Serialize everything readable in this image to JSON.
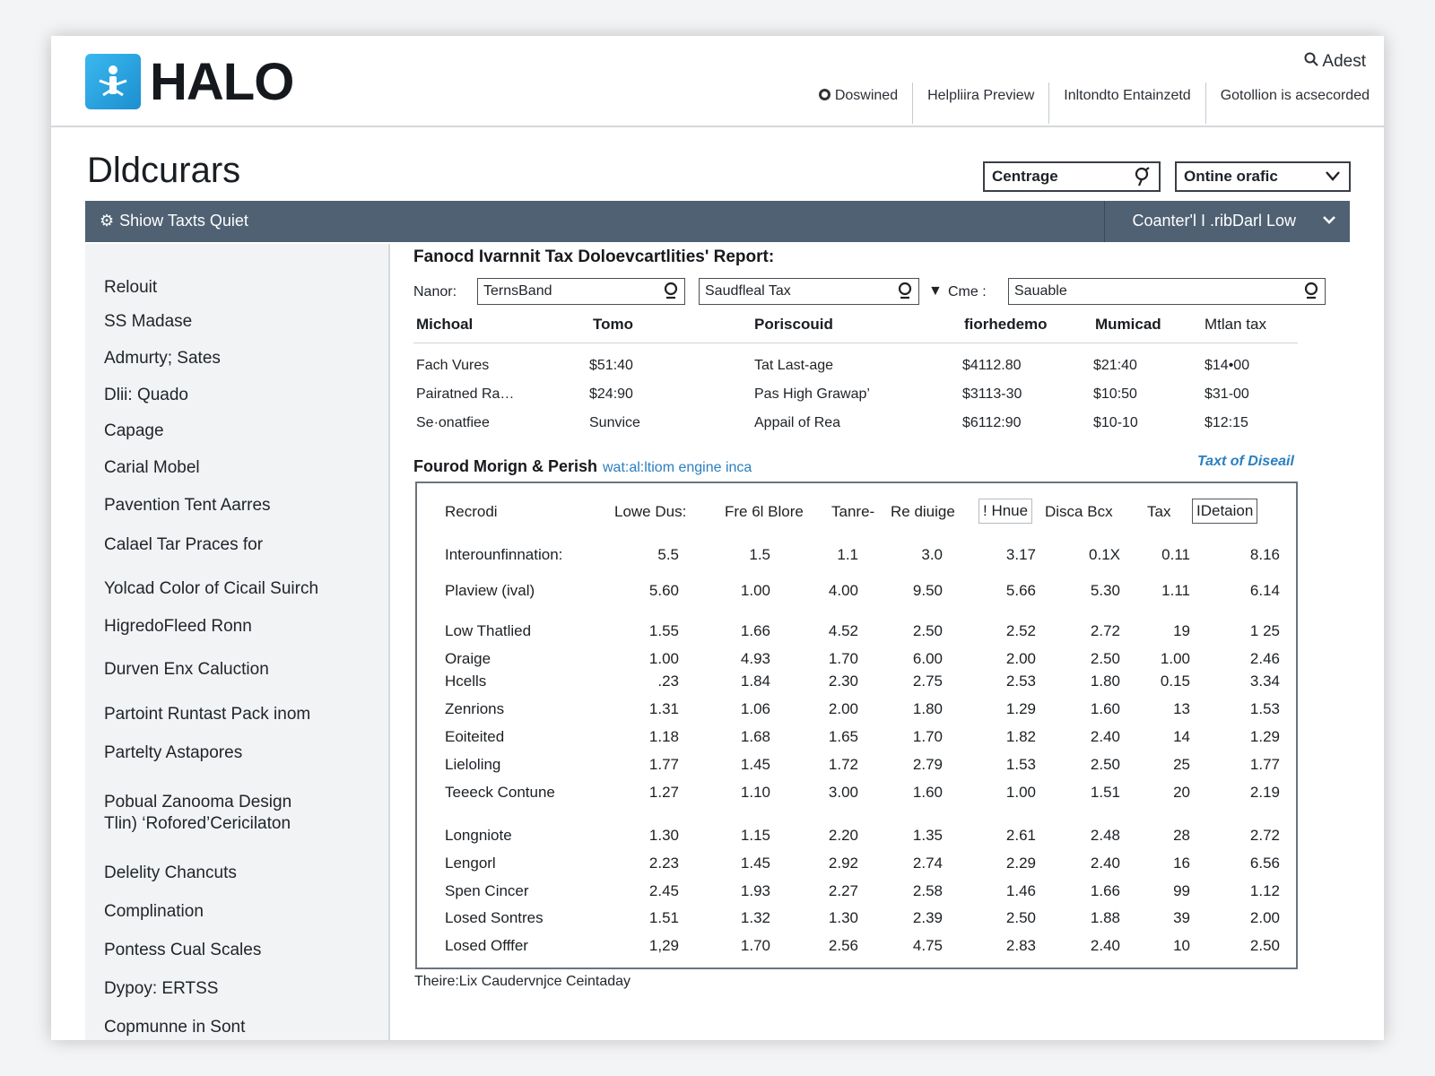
{
  "app": {
    "logo_text": "HALO",
    "user_menu": "Adest",
    "top_nav": [
      "Doswined",
      "Helpliira Preview",
      "Inltondto Entainzetd",
      "Gotollion is acsecorded"
    ]
  },
  "page": {
    "title": "Dldcurars",
    "select1": "Centrage",
    "select2": "Ontine orafic"
  },
  "toolbar": {
    "show_taxes": "Shiow Taxts Quiet",
    "filter": "Coanter'l I .ribDarl Low"
  },
  "sidebar": {
    "items": [
      "Relouit",
      "SS Madase",
      "Admurty; Sates",
      "Dlii: Quado",
      "Capage",
      "Carial Mobel",
      "Pavention Tent Aarres",
      "Calael Tar Praces for",
      "Yolcad Color of Cicail Suirch",
      "HigredoFleed Ronn",
      "Durven Enx Caluction",
      "Partoint Runtast Pack inom",
      "Partelty Astapores",
      "Pobual Zanooma Design",
      "Tlin)  ‘Rofored’Cericilaton",
      "Delelity Chancuts",
      "Complination",
      "Pontess Cual Scales",
      "Dypoy: ERTSS",
      "Copmunne in Sont"
    ]
  },
  "report": {
    "title": "Fanocd  Ivarnnit  Tax  Doloevcartlities'  Report:",
    "filter_label1": "Nanor:",
    "filter_value1": "TernsBand",
    "filter_value2": "Saudfleal Tax",
    "filter_label3": "Cme :",
    "filter_value3": "Sauable",
    "summary": {
      "headers": [
        "Michoal",
        "Tomo",
        "Poriscouid",
        "fiorhedemo",
        "Mumicad",
        "Mtlan tax"
      ],
      "rows": [
        [
          "Fach Vures",
          "$51:40",
          "Tat Last-age",
          "$4112.80",
          "$21:40",
          "$14•00"
        ],
        [
          "Pairatned Ra…",
          "$24:90",
          "Pas High Grawap’",
          "$3113-30",
          "$10:50",
          "$31-00"
        ],
        [
          "Se·onatfiee",
          "Sunvice",
          "Appail of Rea",
          "$6112:90",
          "$10-10",
          "$12:15"
        ]
      ]
    },
    "section2_title": "Fourod Morign & Perish",
    "section2_sub": "wat:al:ltiom engine inca",
    "section2_link": "Taxt of Diseail",
    "detail": {
      "headers": [
        "Recrodi",
        "Lowe Dus:",
        "Fre 6l Blore",
        "Tanre-",
        "Re diuige",
        "! Hnue",
        "Disca Bcx",
        "Tax",
        "IDetaion"
      ],
      "rows": [
        [
          "Interounfinnation:",
          "5.5",
          "1.5",
          "1.1",
          "3.0",
          "3.17",
          "0.1X",
          "0.11",
          "8.16"
        ],
        [
          "Plaview (ival)",
          "5.60",
          "1.00",
          "4.00",
          "9.50",
          "5.66",
          "5.30",
          "1.11",
          "6.14"
        ],
        [
          "Low Thatlied",
          "1.55",
          "1.66",
          "4.52",
          "2.50",
          "2.52",
          "2.72",
          "19",
          "1 25"
        ],
        [
          "Oraige",
          "1.00",
          "4.93",
          "1.70",
          "6.00",
          "2.00",
          "2.50",
          "1.00",
          "2.46"
        ],
        [
          "Hcells",
          ".23",
          "1.84",
          "2.30",
          "2.75",
          "2.53",
          "1.80",
          "0.15",
          "3.34"
        ],
        [
          "Zenrions",
          "1.31",
          "1.06",
          "2.00",
          "1.80",
          "1.29",
          "1.60",
          "13",
          "1.53"
        ],
        [
          "Eoiteited",
          "1.18",
          "1.68",
          "1.65",
          "1.70",
          "1.82",
          "2.40",
          "14",
          "1.29"
        ],
        [
          "Lieloling",
          "1.77",
          "1.45",
          "1.72",
          "2.79",
          "1.53",
          "2.50",
          "25",
          "1.77"
        ],
        [
          "Teeeck Contune",
          "1.27",
          "1.10",
          "3.00",
          "1.60",
          "1.00",
          "1.51",
          "20",
          "2.19"
        ],
        [
          "Longniote",
          "1.30",
          "1.15",
          "2.20",
          "1.35",
          "2.61",
          "2.48",
          "28",
          "2.72"
        ],
        [
          "Lengorl",
          "2.23",
          "1.45",
          "2.92",
          "2.74",
          "2.29",
          "2.40",
          "16",
          "6.56"
        ],
        [
          "Spen Cincer",
          "2.45",
          "1.93",
          "2.27",
          "2.58",
          "1.46",
          "1.66",
          "99",
          "1.12"
        ],
        [
          "Losed Sontres",
          "1.51",
          "1.32",
          "1.30",
          "2.39",
          "2.50",
          "1.88",
          "39",
          "2.00"
        ],
        [
          "Losed Offfer",
          "1,29",
          "1.70",
          "2.56",
          "4.75",
          "2.83",
          "2.40",
          "10",
          "2.50"
        ]
      ]
    },
    "footer_note": "Theire:Lix Caudervnjce Ceintaday"
  },
  "colors": {
    "toolbar_bg": "#4f6173",
    "logo_blue": "#1c8fd0",
    "link_blue": "#2a7fc0"
  }
}
